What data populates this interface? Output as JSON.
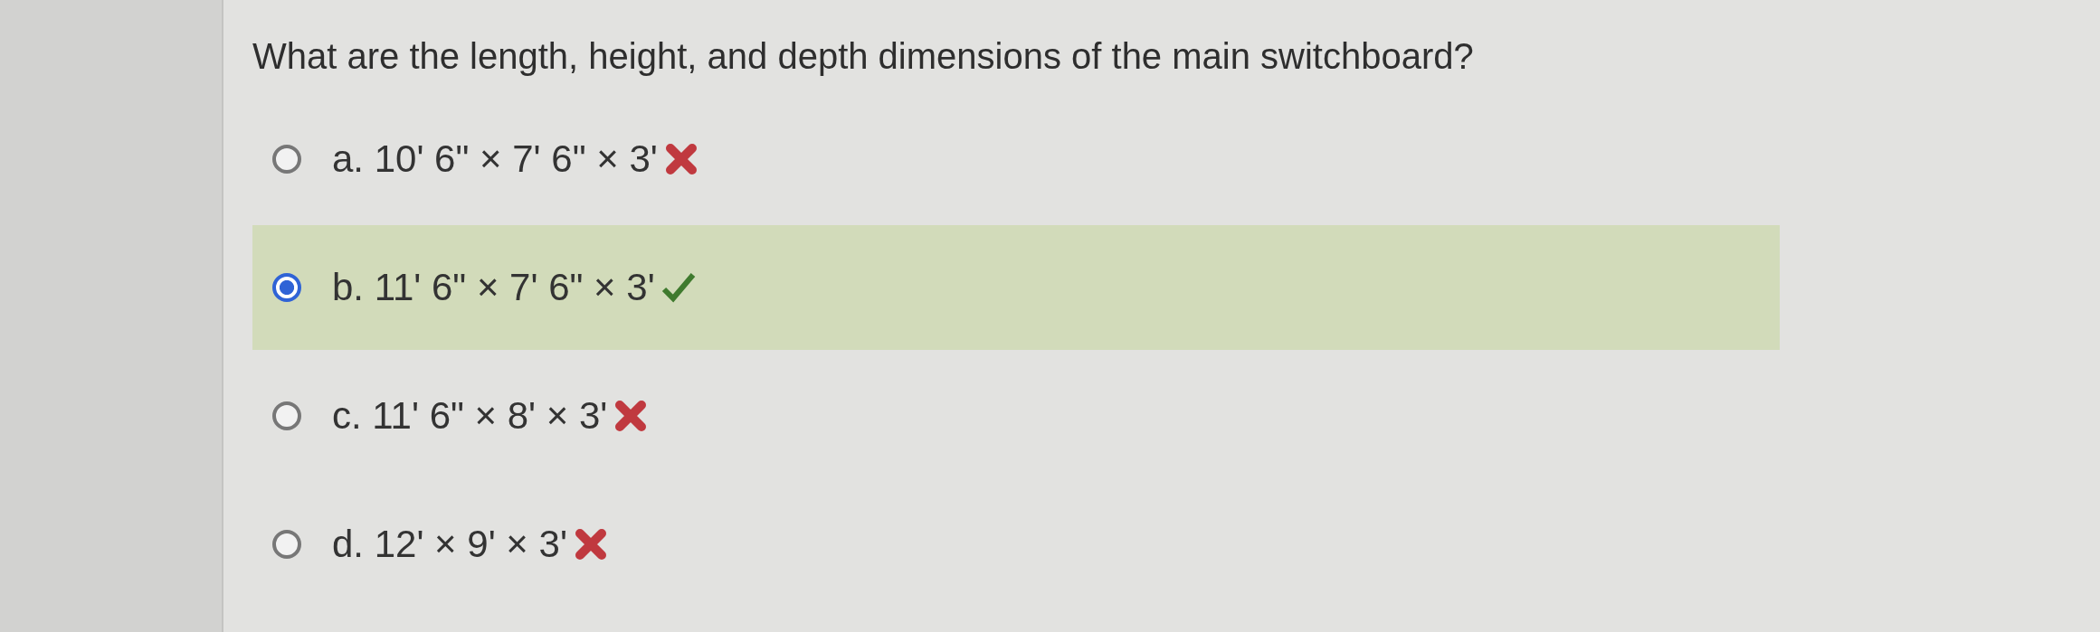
{
  "question": "What are the length, height, and depth dimensions of the main switchboard?",
  "options": [
    {
      "label": "a. 10' 6\" × 7' 6\" × 3'",
      "selected": false,
      "correct": false
    },
    {
      "label": "b. 11' 6\" × 7' 6\" × 3'",
      "selected": true,
      "correct": true
    },
    {
      "label": "c. 11' 6\" × 8' × 3'",
      "selected": false,
      "correct": false
    },
    {
      "label": "d. 12' × 9' × 3'",
      "selected": false,
      "correct": false
    }
  ]
}
